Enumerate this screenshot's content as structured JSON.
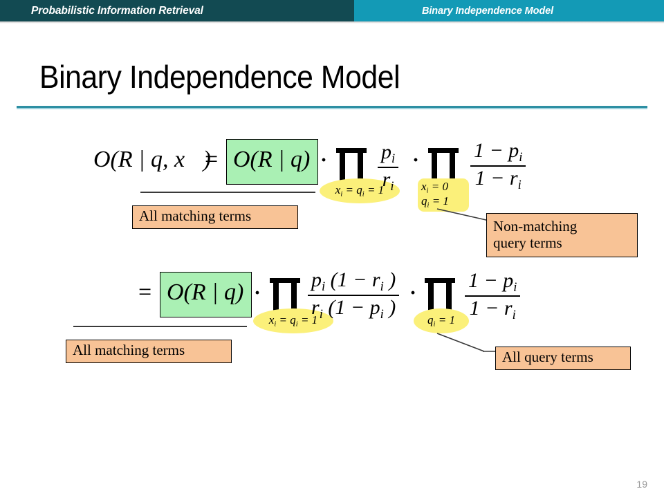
{
  "header": {
    "left_title": "Probabilistic Information Retrieval",
    "right_title": "Binary Independence Model",
    "left_color": "#124a52",
    "right_color": "#139ab6"
  },
  "slide": {
    "title": "Binary Independence Model",
    "rule_color": "#2e8fa3",
    "page_number": "19"
  },
  "equations": {
    "row1": {
      "lhs": "O(R | q, x⃗)",
      "equals": "=",
      "highlighted_term": "O(R | q)",
      "dot1": "·",
      "product1": {
        "symbol": "∏",
        "index": "x i  = q i  = 1",
        "index_parts": [
          "x",
          "i",
          " = ",
          "q",
          "i",
          " = 1"
        ],
        "numerator": "p i",
        "denominator": "r i"
      },
      "dot2": "·",
      "product2": {
        "symbol": "∏",
        "index_line1": "x i  = 0",
        "index_line2": "q i  = 1",
        "numerator": "1 − p i",
        "denominator": "1 − r i"
      }
    },
    "row2": {
      "equals": "=",
      "highlighted_term": "O(R | q)",
      "dot1": "·",
      "product1": {
        "symbol": "∏",
        "index": "x i  = q i  = 1",
        "numerator": "p i (1 − r i )",
        "denominator": "r i (1 − p i )"
      },
      "dot2": "·",
      "product2": {
        "symbol": "∏",
        "index": "q i  = 1",
        "numerator": "1 − p i",
        "denominator": "1 − r i"
      }
    }
  },
  "callouts": {
    "top_left": "All matching terms",
    "top_right": "Non-matching\nquery terms",
    "bottom_left": "All matching terms",
    "bottom_right": "All query terms",
    "fill_color": "#f8c396"
  },
  "highlight": {
    "green_fill": "#aaf0b4",
    "yellow_fill": "#fbf07a"
  },
  "symbols": {
    "p": "p",
    "r": "r",
    "i": "i",
    "one": "1",
    "minus": "−",
    "O": "O",
    "R": "R",
    "q": "q",
    "x": "x",
    "vec_x": "x⃗",
    "bar": "|",
    "comma": ",",
    "lparen": "(",
    "rparen": ")",
    "eq": "=",
    "zero": "0",
    "dot": "·"
  }
}
